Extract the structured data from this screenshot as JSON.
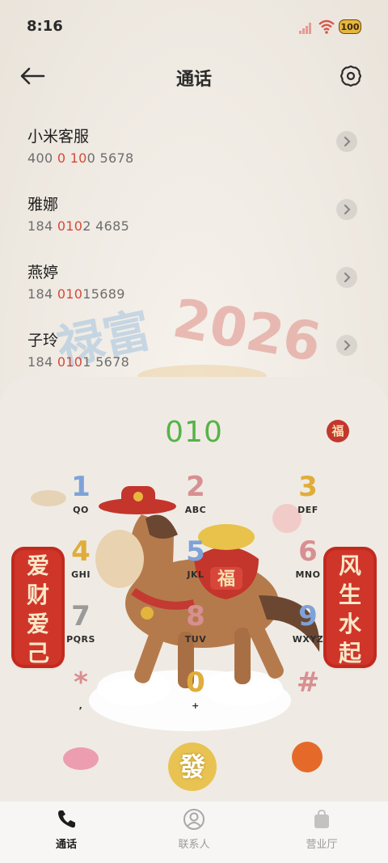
{
  "status": {
    "time": "8:16",
    "battery": "100"
  },
  "header": {
    "title": "通话"
  },
  "calls": [
    {
      "name": "小米客服",
      "num_pre": "400 ",
      "num_hl": "0",
      "num_mid": " ",
      "num_hl2": "10",
      "num_post": "0 5678"
    },
    {
      "name": "雅娜",
      "num_pre": "184 ",
      "num_hl": "010",
      "num_mid": "",
      "num_hl2": "",
      "num_post": "2 4685"
    },
    {
      "name": "燕婷",
      "num_pre": "184 ",
      "num_hl": "010",
      "num_mid": "",
      "num_hl2": "",
      "num_post": "15689"
    },
    {
      "name": "子玲",
      "num_pre": "184 ",
      "num_hl": "010",
      "num_mid": "",
      "num_hl2": "",
      "num_post": "1 5678"
    }
  ],
  "decor": {
    "year": "2026"
  },
  "dialer": {
    "digits": "010",
    "fu": "福",
    "keys": [
      {
        "d": "1",
        "l": "QO"
      },
      {
        "d": "2",
        "l": "ABC"
      },
      {
        "d": "3",
        "l": "DEF"
      },
      {
        "d": "4",
        "l": "GHI"
      },
      {
        "d": "5",
        "l": "JKL"
      },
      {
        "d": "6",
        "l": "MNO"
      },
      {
        "d": "7",
        "l": "PQRS"
      },
      {
        "d": "8",
        "l": "TUV"
      },
      {
        "d": "9",
        "l": "WXYZ"
      },
      {
        "d": "*",
        "l": ","
      },
      {
        "d": "0",
        "l": "+"
      },
      {
        "d": "#",
        "l": ""
      }
    ],
    "banner_left": [
      "爱",
      "财",
      "爱",
      "己"
    ],
    "banner_right": [
      "风",
      "生",
      "水",
      "起"
    ],
    "call_button": "發"
  },
  "nav": [
    {
      "label": "通话",
      "icon": "phone-icon"
    },
    {
      "label": "联系人",
      "icon": "person-icon"
    },
    {
      "label": "营业厅",
      "icon": "bag-icon"
    }
  ],
  "colors": {
    "accent_green": "#56b348",
    "highlight_red": "#d24a3c",
    "banner_red": "#d0352a"
  }
}
